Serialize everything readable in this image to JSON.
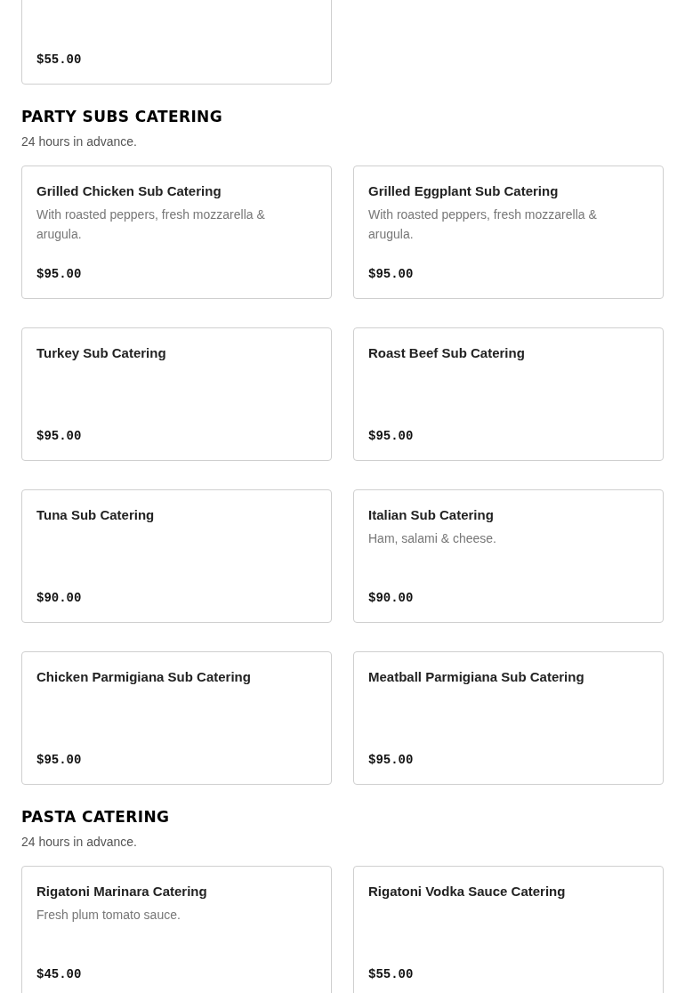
{
  "sections": [
    {
      "items": [
        {
          "price": "$55.00"
        }
      ]
    },
    {
      "title": "PARTY SUBS CATERING",
      "note": "24 hours in advance.",
      "items": [
        {
          "name": "Grilled Chicken Sub Catering",
          "description": "With roasted peppers, fresh mozzarella & arugula.",
          "price": "$95.00"
        },
        {
          "name": "Grilled Eggplant Sub Catering",
          "description": "With roasted peppers, fresh mozzarella & arugula.",
          "price": "$95.00"
        },
        {
          "name": "Turkey Sub Catering",
          "price": "$95.00"
        },
        {
          "name": "Roast Beef Sub Catering",
          "price": "$95.00"
        },
        {
          "name": "Tuna Sub Catering",
          "price": "$90.00"
        },
        {
          "name": "Italian Sub Catering",
          "description": "Ham, salami & cheese.",
          "price": "$90.00"
        },
        {
          "name": "Chicken Parmigiana Sub Catering",
          "price": "$95.00"
        },
        {
          "name": "Meatball Parmigiana Sub Catering",
          "price": "$95.00"
        }
      ]
    },
    {
      "title": "PASTA CATERING",
      "note": "24 hours in advance.",
      "items": [
        {
          "name": "Rigatoni Marinara Catering",
          "description": "Fresh plum tomato sauce.",
          "price": "$45.00"
        },
        {
          "name": "Rigatoni Vodka Sauce Catering",
          "price": "$55.00"
        }
      ]
    }
  ]
}
